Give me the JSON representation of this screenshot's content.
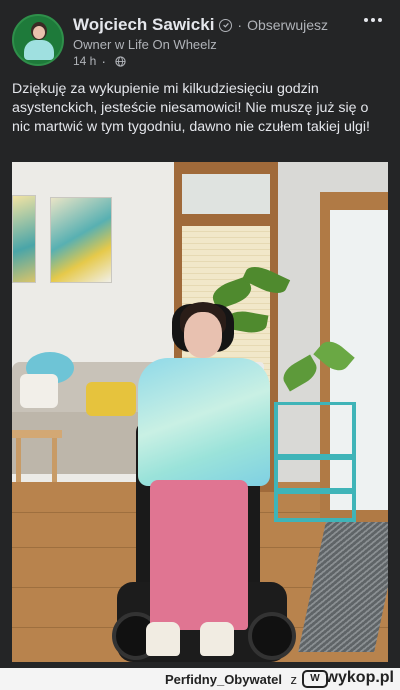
{
  "post": {
    "author": "Wojciech Sawicki",
    "follow_label": "Obserwujesz",
    "subtitle": "Owner w Life On Wheelz",
    "time": "14 h",
    "text": "Dziękuję za wykupienie mi kilkudziesięciu godzin asystenckich, jesteście niesamowici! Nie muszę już się o nic martwić w tym tygodniu, dawno nie czułem takiej ulgi!"
  },
  "footer": {
    "username": "Perfidny_Obywatel",
    "connector": "z",
    "brand": "wykop.pl"
  },
  "colors": {
    "background": "#242526",
    "text_primary": "#e4e6eb",
    "text_secondary": "#b0b3b8",
    "footer_background": "#f4f4f4"
  }
}
